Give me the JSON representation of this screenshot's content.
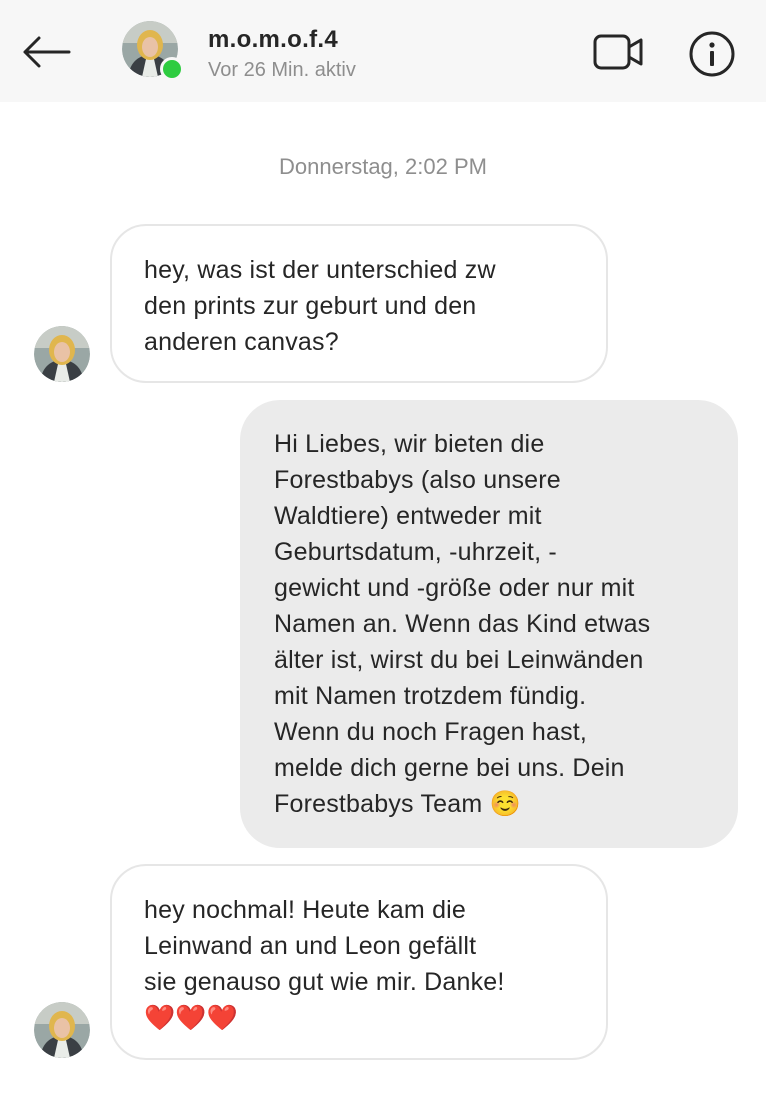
{
  "header": {
    "username": "m.o.m.o.f.4",
    "status": "Vor 26 Min. aktiv",
    "online_color": "#2ecc40",
    "icons": {
      "back": "arrow-left-icon",
      "video": "video-camera-icon",
      "info": "info-icon"
    }
  },
  "conversation": {
    "timestamp": "Donnerstag, 2:02 PM",
    "messages": [
      {
        "direction": "incoming",
        "text": "hey, was ist der unterschied zw\nden prints zur geburt und den\nanderen canvas?"
      },
      {
        "direction": "outgoing",
        "text": "Hi Liebes, wir bieten die\nForestbabys (also unsere\nWaldtiere) entweder mit\nGeburtsdatum, -uhrzeit, -\ngewicht und -größe oder nur mit\nNamen an. Wenn das Kind etwas\nälter ist, wirst du bei Leinwänden\nmit Namen trotzdem fündig.\nWenn du noch Fragen hast,\nmelde dich gerne bei uns. Dein\nForestbabys Team ☺️"
      },
      {
        "direction": "incoming",
        "text": "hey nochmal! Heute kam die\nLeinwand an und Leon gefällt\nsie genauso gut wie mir. Danke!\n❤️❤️❤️"
      }
    ]
  }
}
